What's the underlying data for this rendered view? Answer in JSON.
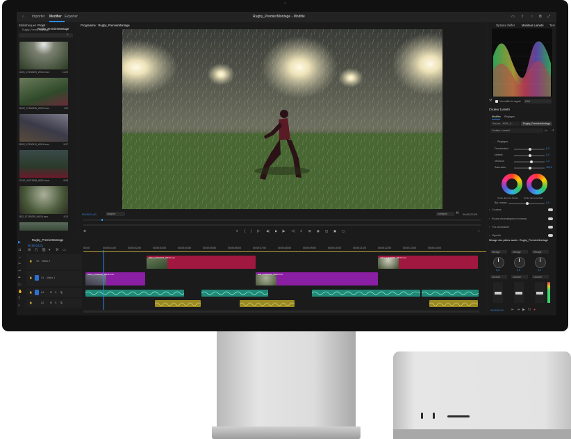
{
  "menubar": {
    "tabs": [
      {
        "label": "Importer",
        "active": false
      },
      {
        "label": "Modifier",
        "active": true
      },
      {
        "label": "Exporter",
        "active": false
      }
    ],
    "document_title": "Rugby_PremierMontage - Modifié"
  },
  "project_panel": {
    "tab_bibliotheques": "Bibliothèques",
    "tab_project": "Projet : Rugby_PremierMontage",
    "bin_name": "Rugby_PremierMontage",
    "clips": [
      {
        "name": "A001_07150609_W012.mov",
        "duration": "11;29"
      },
      {
        "name": "B002_07150926_W023.mov",
        "duration": "7;00"
      },
      {
        "name": "B002_07150910_W016.mov",
        "duration": "9;07"
      },
      {
        "name": "D012_04071958_W034.mov",
        "duration": "8;08"
      },
      {
        "name": "B02_07150235_W018.mov",
        "duration": "4;24"
      }
    ]
  },
  "program_monitor": {
    "title": "Programme : Rugby_PremierMontage",
    "timecode_current": "00;00;01;01",
    "fit_label": "Adapter",
    "quality_label": "Intégrale",
    "timecode_duration": "00;00;23;29"
  },
  "scopes_panel": {
    "tab_effects": "Options d'effet",
    "tab_lumetri_scopes": "Moniteur Lumetri",
    "tab_text": "Text",
    "clamp_label": "Verrouiller le signal",
    "bit_depth": "8 bit"
  },
  "lumetri": {
    "title": "Couleur Lumetri",
    "tab_modify": "Modifier",
    "tab_settings": "Réglages",
    "source_label": "Source - A001_0...",
    "sequence_label": "Rugby_PremierMontage...",
    "preset_label": "Couleur Lumetri",
    "section_reglages": "Réglages",
    "sliders": [
      {
        "label": "Décoloration",
        "value": "0,0",
        "pos": 0.5
      },
      {
        "label": "Netteté",
        "value": "0,0",
        "pos": 0.5
      },
      {
        "label": "Vibrance",
        "value": "1,3",
        "pos": 0.55
      },
      {
        "label": "Saturation",
        "value": "100,0",
        "pos": 0.5
      }
    ],
    "wheel_labels": [
      "Teinte des tons foncés",
      "Teinte des tons clairs"
    ],
    "balance_label": "Bal. teintes",
    "balance_value": "0,0",
    "sections": [
      "Courbes",
      "Roues chromatiques et corresp.",
      "TSL secondaire",
      "Vignette"
    ]
  },
  "timeline": {
    "sequence_name": "Rugby_PremierMontage",
    "timecode": "00;00;01;01",
    "ruler": [
      "00;00",
      "00;00;01;00",
      "00;00;02;00",
      "00;00;03;00",
      "00;00;04;00",
      "00;00;05;00",
      "00;00;06;00",
      "00;00;07;00",
      "00;00;08;00",
      "00;00;09;00",
      "00;00;10;00",
      "00;00;11;00",
      "00;00;12;00",
      "00;00;13;00",
      "00;00;14;00"
    ],
    "tracks": [
      {
        "id": "V2",
        "name": "Vidéo 2"
      },
      {
        "id": "V1",
        "name": "Vidéo 1"
      },
      {
        "id": "A1",
        "name": ""
      },
      {
        "id": "A2",
        "name": ""
      }
    ],
    "clips_v2": [
      "B002_07150926_W023.mov",
      "A001_07150609_W012.mov"
    ],
    "clips_v1": [
      "B002_07150910_W016.mov",
      "B02_07150235_W018.mov"
    ]
  },
  "audio_mixer": {
    "title": "Mixage des pistes audio : Rugby_PremierMontage",
    "dropdowns": [
      "Mixage",
      "Mixage",
      "Mixage"
    ],
    "knob_values": [
      "0,0",
      "0,0",
      "0,0"
    ],
    "mode_labels": [
      "Lecture",
      "Lecture",
      "Lecture"
    ],
    "bottom_timecode": "00;00;01;01"
  },
  "colors": {
    "accent": "#2d8ceb",
    "clip_magenta": "#a0183f",
    "clip_purple": "#8b1fa3",
    "clip_teal": "#1f8a78",
    "clip_gold": "#9a8a22"
  }
}
